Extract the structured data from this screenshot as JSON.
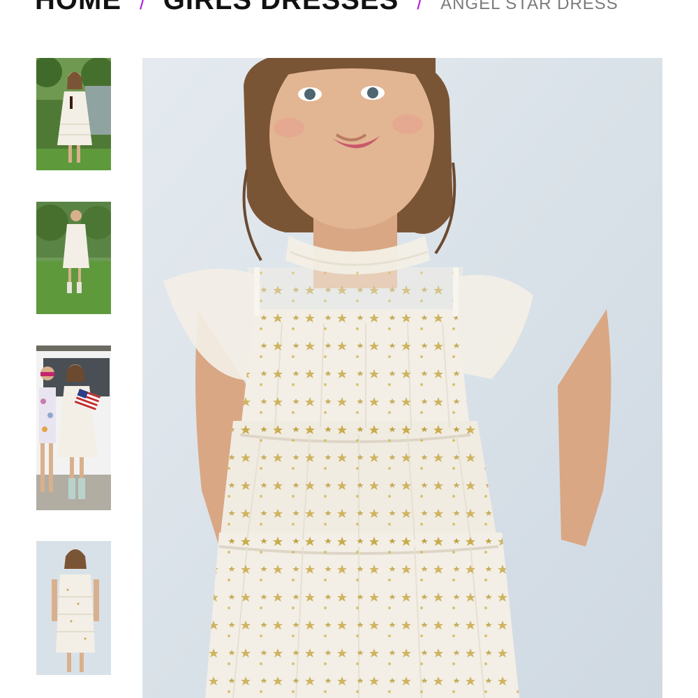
{
  "breadcrumb": {
    "items": [
      {
        "label": "HOME"
      },
      {
        "label": "GIRLS DRESSES"
      }
    ],
    "separator": "/",
    "current": "ANGEL STAR DRESS"
  },
  "gallery": {
    "thumbnails": [
      {
        "scene": "girl holding bottle in garden wearing white ruffle dress"
      },
      {
        "scene": "girl standing on lawn in white dress and cowboy boots"
      },
      {
        "scene": "two girls by white car holding american flag"
      },
      {
        "scene": "girl in white tiered star dress against light backdrop"
      }
    ],
    "main_image": {
      "scene": "girl wearing white tiered tulle dress with gold stars"
    }
  },
  "colors": {
    "accent": "#b020d8",
    "text_primary": "#111111",
    "text_secondary": "#7a7a7a",
    "dress": "#f3efe6",
    "star_gold": "#c9a94a",
    "backdrop": "#dde5ec",
    "grass": "#5e9a3c"
  }
}
